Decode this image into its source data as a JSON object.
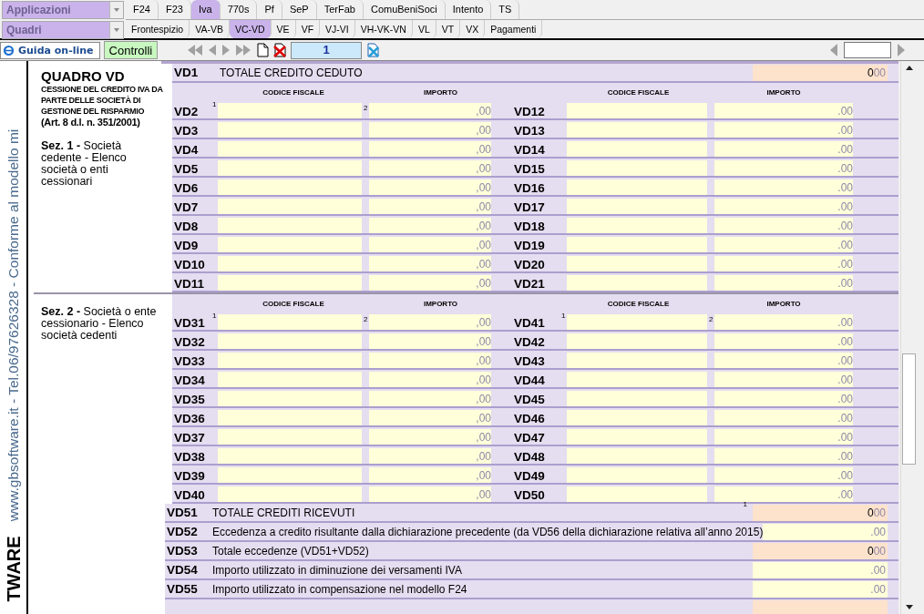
{
  "selectors": [
    {
      "label": "Applicazioni"
    },
    {
      "label": "Quadri"
    }
  ],
  "module_tabs": [
    {
      "label": "F24",
      "selected": false
    },
    {
      "label": "F23",
      "selected": false
    },
    {
      "label": "Iva",
      "selected": true
    },
    {
      "label": "770s",
      "selected": false
    },
    {
      "label": "Pf",
      "selected": false
    },
    {
      "label": "SeP",
      "selected": false
    },
    {
      "label": "TerFab",
      "selected": false
    },
    {
      "label": "ComuBeniSoci",
      "selected": false
    },
    {
      "label": "Intento",
      "selected": false
    },
    {
      "label": "TS",
      "selected": false
    }
  ],
  "quadro_tabs": [
    {
      "label": "Frontespizio",
      "selected": false
    },
    {
      "label": "VA-VB",
      "selected": false
    },
    {
      "label": "VC-VD",
      "selected": true
    },
    {
      "label": "VE",
      "selected": false
    },
    {
      "label": "VF",
      "selected": false
    },
    {
      "label": "VJ-VI",
      "selected": false
    },
    {
      "label": "VH-VK-VN",
      "selected": false
    },
    {
      "label": "VL",
      "selected": false
    },
    {
      "label": "VT",
      "selected": false
    },
    {
      "label": "VX",
      "selected": false
    },
    {
      "label": "Pagamenti",
      "selected": false
    }
  ],
  "toolbar": {
    "help": "Guida on-line",
    "checks": "Controlli",
    "page": "1"
  },
  "side_strip": {
    "text": "www.gbsoftware.it - Tel.06/97626328 - Conforme al modello mi",
    "brand": "TWARE"
  },
  "form": {
    "title": "QUADRO VD",
    "subtitle": "CESSIONE DEL CREDITO IVA DA PARTE DELLE SOCIETÀ DI GESTIONE DEL RISPARMIO",
    "reference": "(Art. 8 d.l. n. 351/2001)",
    "total_row": {
      "code": "VD1",
      "label": "TOTALE CREDITO CEDUTO",
      "value": "0",
      "decimals": "00",
      "kind": "computed"
    },
    "sections": [
      {
        "description": "**Sez. 1 -** Società cedente - Elenco società o enti cessionari",
        "headers": [
          "CODICE FISCALE",
          "IMPORTO",
          "CODICE FISCALE",
          "IMPORTO"
        ],
        "marks": [
          "1",
          "2"
        ],
        "rows": [
          {
            "left_code": "VD2",
            "left_amount": ",00",
            "right_code": "VD12",
            "right_amount": ".00"
          },
          {
            "left_code": "VD3",
            "left_amount": ",00",
            "right_code": "VD13",
            "right_amount": ".00"
          },
          {
            "left_code": "VD4",
            "left_amount": ",00",
            "right_code": "VD14",
            "right_amount": ".00"
          },
          {
            "left_code": "VD5",
            "left_amount": ",00",
            "right_code": "VD15",
            "right_amount": ".00"
          },
          {
            "left_code": "VD6",
            "left_amount": ",00",
            "right_code": "VD16",
            "right_amount": ".00"
          },
          {
            "left_code": "VD7",
            "left_amount": ",00",
            "right_code": "VD17",
            "right_amount": ".00"
          },
          {
            "left_code": "VD8",
            "left_amount": ",00",
            "right_code": "VD18",
            "right_amount": ".00"
          },
          {
            "left_code": "VD9",
            "left_amount": ",00",
            "right_code": "VD19",
            "right_amount": ".00"
          },
          {
            "left_code": "VD10",
            "left_amount": ",00",
            "right_code": "VD20",
            "right_amount": ".00"
          },
          {
            "left_code": "VD11",
            "left_amount": ",00",
            "right_code": "VD21",
            "right_amount": ".00"
          }
        ]
      },
      {
        "description": "**Sez. 2 -** Società o ente cessionario - Elenco società cedenti",
        "headers": [
          "CODICE FISCALE",
          "IMPORTO",
          "CODICE FISCALE",
          "IMPORTO"
        ],
        "marks": [
          "1",
          "2",
          "1",
          "2"
        ],
        "rows": [
          {
            "left_code": "VD31",
            "left_amount": ",00",
            "right_code": "VD41",
            "right_amount": ".00"
          },
          {
            "left_code": "VD32",
            "left_amount": ",00",
            "right_code": "VD42",
            "right_amount": ".00"
          },
          {
            "left_code": "VD33",
            "left_amount": ",00",
            "right_code": "VD43",
            "right_amount": ".00"
          },
          {
            "left_code": "VD34",
            "left_amount": ",00",
            "right_code": "VD44",
            "right_amount": ".00"
          },
          {
            "left_code": "VD35",
            "left_amount": ",00",
            "right_code": "VD45",
            "right_amount": ".00"
          },
          {
            "left_code": "VD36",
            "left_amount": ",00",
            "right_code": "VD46",
            "right_amount": ".00"
          },
          {
            "left_code": "VD37",
            "left_amount": ",00",
            "right_code": "VD47",
            "right_amount": ".00"
          },
          {
            "left_code": "VD38",
            "left_amount": ",00",
            "right_code": "VD48",
            "right_amount": ".00"
          },
          {
            "left_code": "VD39",
            "left_amount": ",00",
            "right_code": "VD49",
            "right_amount": ".00"
          },
          {
            "left_code": "VD40",
            "left_amount": ",00",
            "right_code": "VD50",
            "right_amount": ".00"
          }
        ]
      }
    ],
    "summary_rows": [
      {
        "code": "VD51",
        "label": "TOTALE CREDITI RICEVUTI",
        "mark": "1",
        "value": "0",
        "decimals": "00",
        "kind": "computed"
      },
      {
        "code": "VD52",
        "label": "Eccedenza a credito risultante dalla dichiarazione precedente (da VD56 della dichiarazione relativa all’anno 2015)",
        "decimals": ".00",
        "kind": "input"
      },
      {
        "code": "VD53",
        "label": "Totale eccedenze (VD51+VD52)",
        "value": "0",
        "decimals": "00",
        "kind": "computed"
      },
      {
        "code": "VD54",
        "label": "Importo utilizzato in diminuzione dei versamenti IVA",
        "decimals": ".00",
        "kind": "input"
      },
      {
        "code": "VD55",
        "label": "Importo utilizzato in compensazione nel modello F24",
        "decimals": ".00",
        "kind": "input"
      }
    ]
  }
}
